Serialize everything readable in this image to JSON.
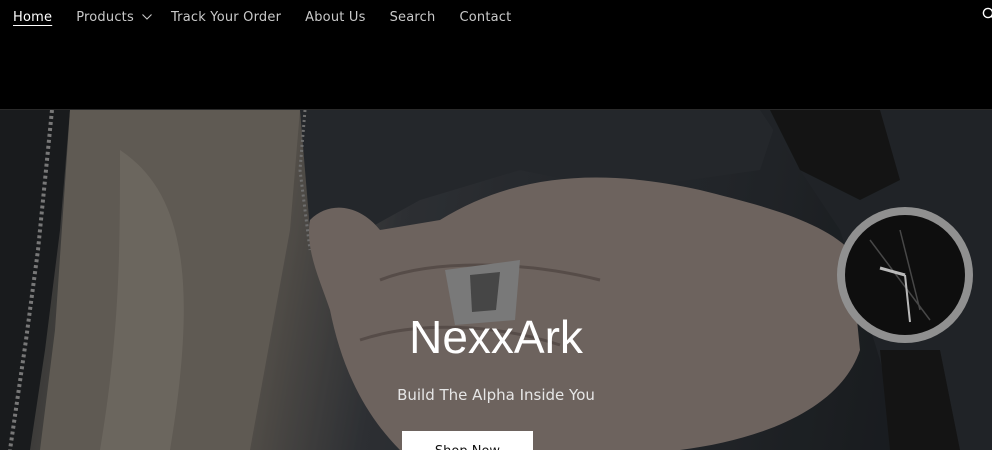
{
  "nav": {
    "items": [
      {
        "label": "Home",
        "active": true
      },
      {
        "label": "Products",
        "has_dropdown": true
      },
      {
        "label": "Track Your Order"
      },
      {
        "label": "About Us"
      },
      {
        "label": "Search"
      },
      {
        "label": "Contact"
      }
    ]
  },
  "header": {
    "right_icon": "search-icon"
  },
  "hero": {
    "title": "NexxArk",
    "subtitle": "Build The Alpha Inside You",
    "button_label": "Shop Now",
    "image_icon": "hand-with-ring-and-watch-image"
  }
}
